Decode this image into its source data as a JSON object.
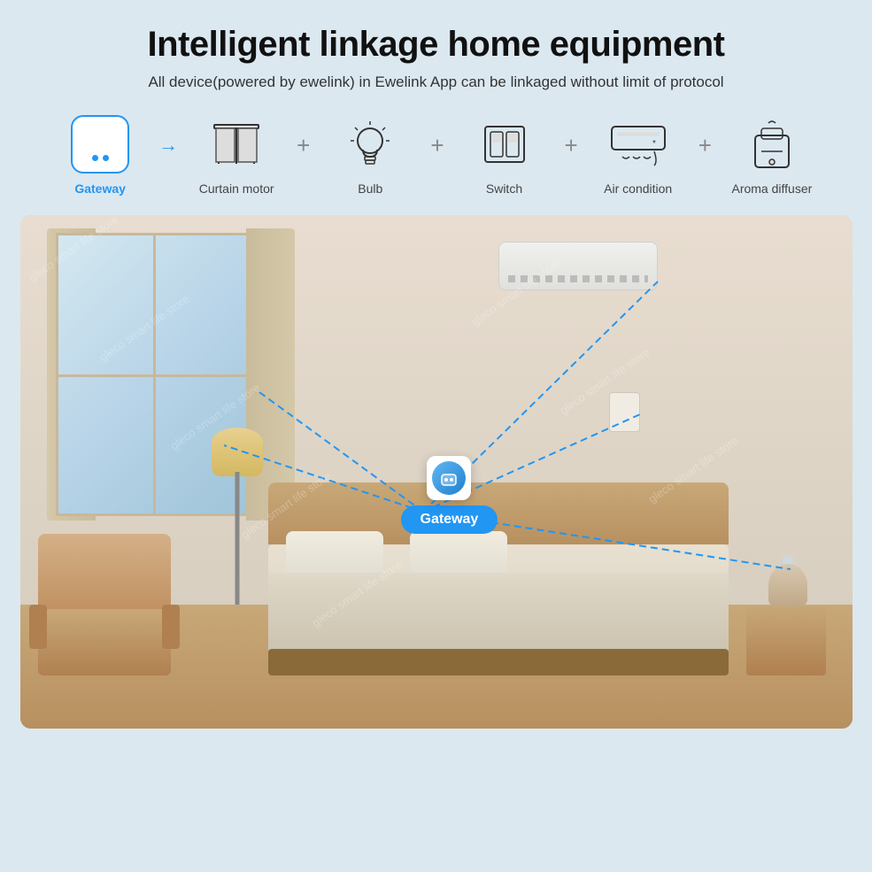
{
  "page": {
    "title": "Intelligent linkage home equipment",
    "subtitle": "All device(powered by ewelink) in Ewelink App can be linkaged without limit of protocol"
  },
  "devices": [
    {
      "id": "gateway",
      "label": "Gateway",
      "labelClass": "blue"
    },
    {
      "id": "curtain-motor",
      "label": "Curtain motor",
      "labelClass": ""
    },
    {
      "id": "bulb",
      "label": "Bulb",
      "labelClass": ""
    },
    {
      "id": "switch",
      "label": "Switch",
      "labelClass": ""
    },
    {
      "id": "air-condition",
      "label": "Air condition",
      "labelClass": ""
    },
    {
      "id": "aroma-diffuser",
      "label": "Aroma diffuser",
      "labelClass": ""
    }
  ],
  "room": {
    "gateway_label": "Gateway"
  }
}
